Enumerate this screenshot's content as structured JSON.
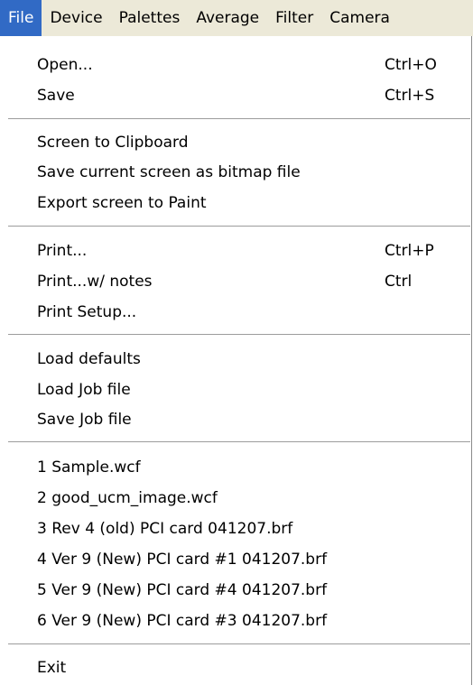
{
  "menubar": {
    "items": [
      {
        "label": "File",
        "active": true
      },
      {
        "label": "Device"
      },
      {
        "label": "Palettes"
      },
      {
        "label": "Average"
      },
      {
        "label": "Filter"
      },
      {
        "label": "Camera"
      }
    ]
  },
  "file_menu": {
    "groups": [
      [
        {
          "label": "Open...",
          "shortcut": "Ctrl+O"
        },
        {
          "label": "Save",
          "shortcut": "Ctrl+S"
        }
      ],
      [
        {
          "label": "Screen to Clipboard"
        },
        {
          "label": "Save current screen as bitmap file"
        },
        {
          "label": "Export screen to Paint"
        }
      ],
      [
        {
          "label": "Print...",
          "shortcut": "Ctrl+P"
        },
        {
          "label": "Print...w/ notes",
          "shortcut": "Ctrl"
        },
        {
          "label": "Print Setup..."
        }
      ],
      [
        {
          "label": "Load defaults"
        },
        {
          "label": "Load Job file"
        },
        {
          "label": "Save Job file"
        }
      ],
      [
        {
          "label": "1 Sample.wcf"
        },
        {
          "label": "2 good_ucm_image.wcf"
        },
        {
          "label": "3 Rev 4 (old) PCI card 041207.brf"
        },
        {
          "label": "4 Ver 9 (New) PCI card #1 041207.brf"
        },
        {
          "label": "5 Ver 9 (New) PCI card #4 041207.brf"
        },
        {
          "label": "6 Ver 9 (New) PCI card #3 041207.brf"
        }
      ],
      [
        {
          "label": "Exit"
        }
      ]
    ]
  }
}
